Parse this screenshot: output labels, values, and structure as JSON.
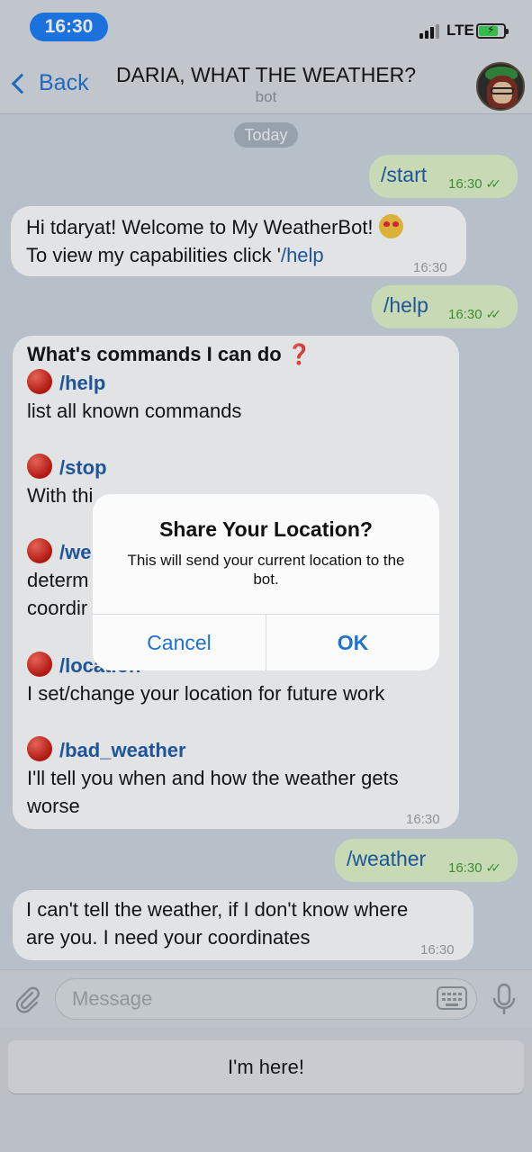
{
  "status_bar": {
    "time": "16:30",
    "network": "LTE"
  },
  "header": {
    "back_label": "Back",
    "title": "DARIA, WHAT THE WEATHER?",
    "subtitle": "bot"
  },
  "chat": {
    "date_label": "Today",
    "messages": [
      {
        "text": "/start",
        "time": "16:30"
      },
      {
        "line1": "Hi tdaryat! Welcome to My WeatherBot!",
        "line2_prefix": "To view my capabilities click '",
        "line2_link": "/help",
        "time": "16:30"
      },
      {
        "text": "/help",
        "time": "16:30"
      },
      {
        "heading": "What's commands I can do",
        "commands": [
          {
            "cmd": "/help",
            "desc": "list all known commands"
          },
          {
            "cmd": "/stop",
            "desc": "With thi"
          },
          {
            "cmd": "/we",
            "desc1": "determ",
            "desc2": "coordir"
          },
          {
            "cmd": "/location",
            "desc": "I set/change your location for future work"
          },
          {
            "cmd": "/bad_weather",
            "desc1": "I'll tell you when and how the weather gets",
            "desc2": "worse"
          }
        ],
        "time": "16:30"
      },
      {
        "text": "/weather",
        "time": "16:30"
      },
      {
        "line1": "I can't tell the weather, if I don't know where",
        "line2": "are you. I need your coordinates",
        "time": "16:30"
      }
    ]
  },
  "alert": {
    "title": "Share Your Location?",
    "message": "This will send your current location to the bot.",
    "cancel": "Cancel",
    "ok": "OK"
  },
  "input": {
    "placeholder": "Message"
  },
  "reply_keyboard": {
    "button": "I'm here!"
  },
  "colors": {
    "accent": "#1f72d0",
    "outgoing_bubble": "#def2c6",
    "incoming_bubble": "#fcfcfd",
    "time_pill": "#1a7cf4"
  }
}
